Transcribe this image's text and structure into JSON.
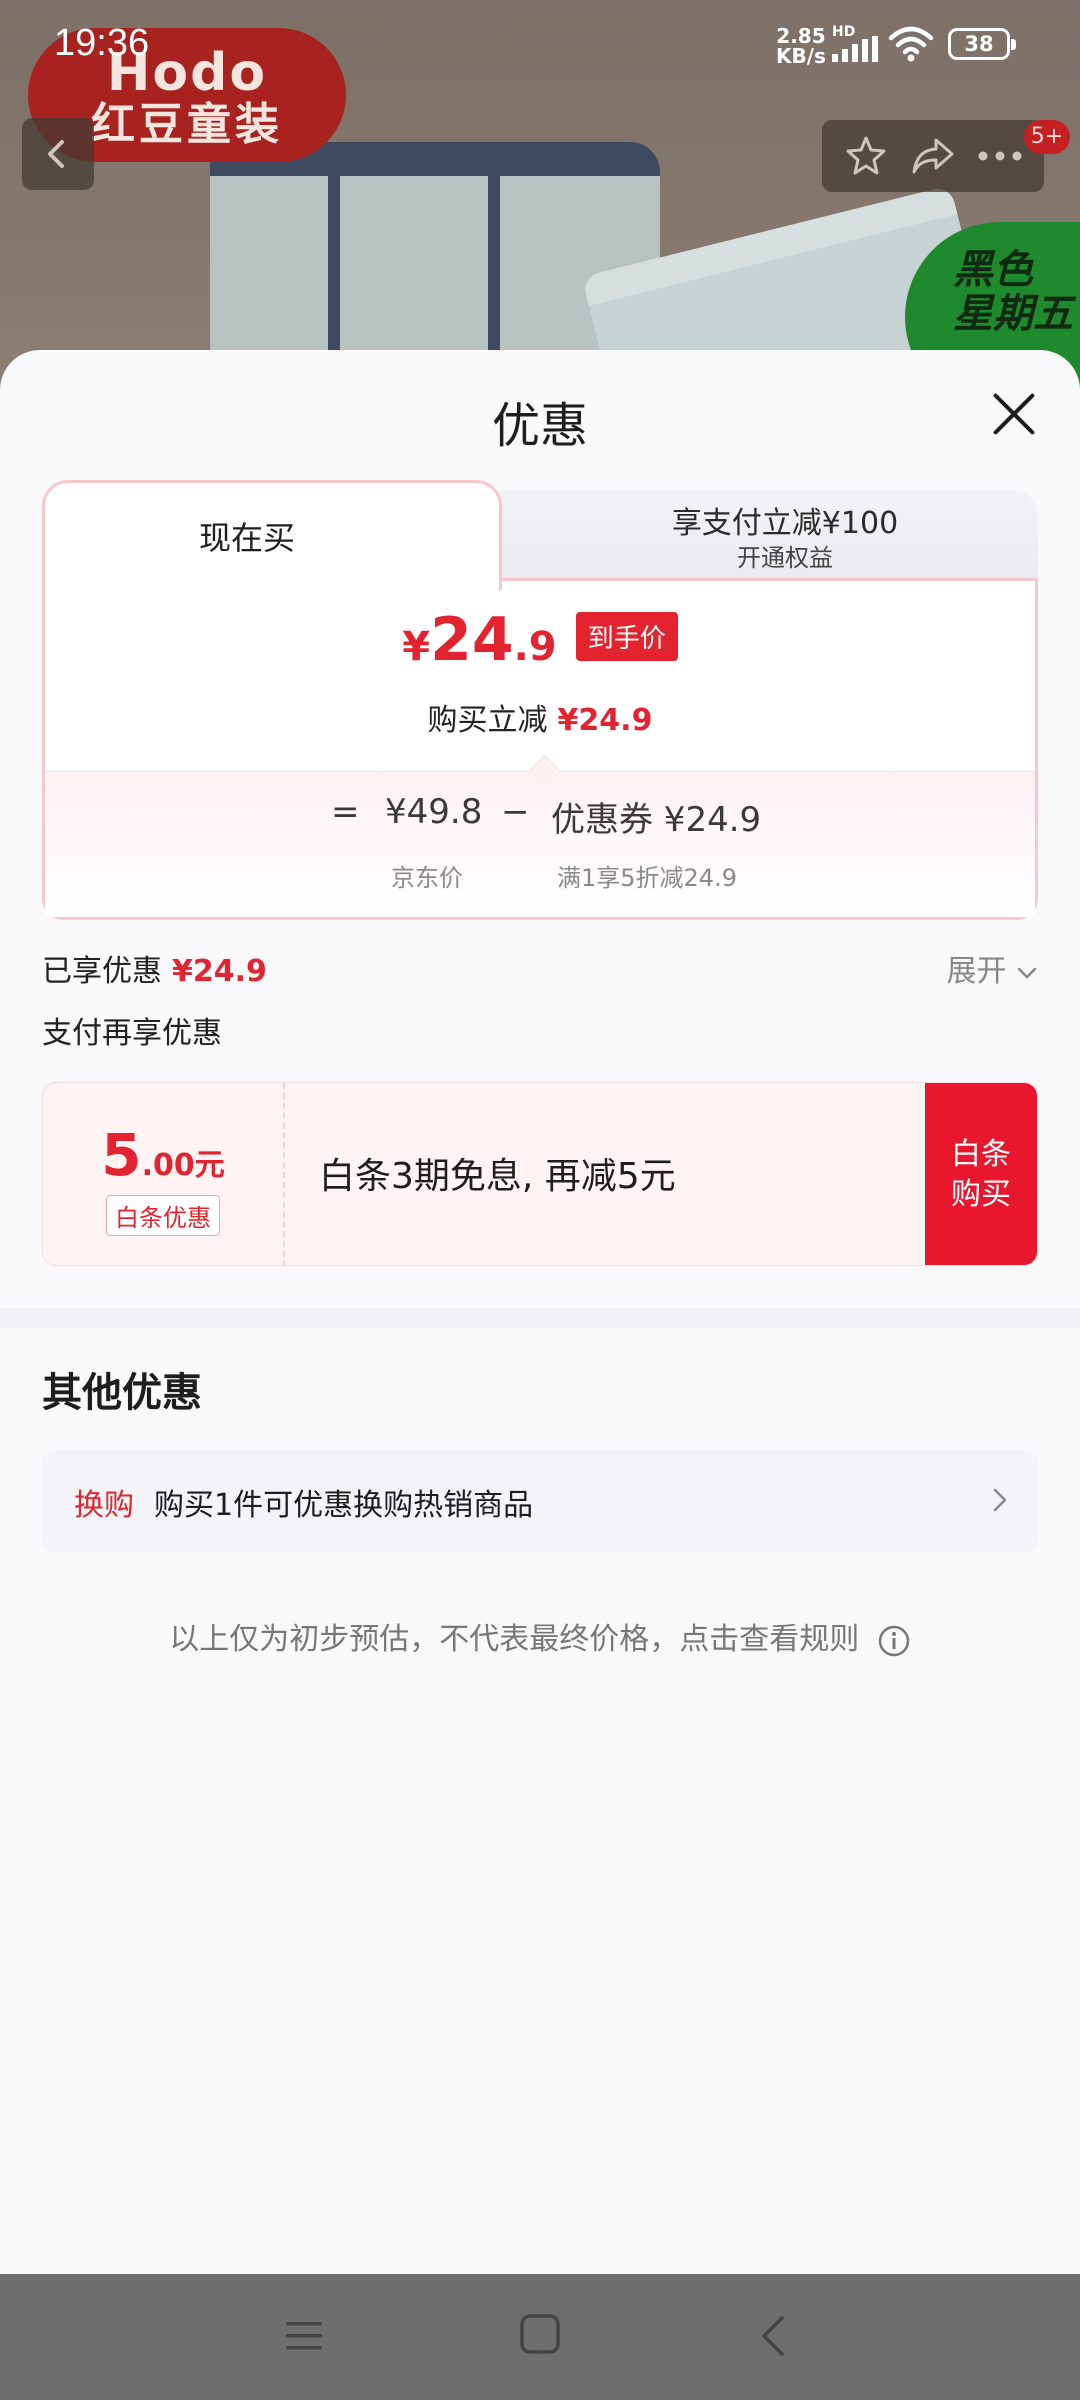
{
  "status_bar": {
    "time": "19:36",
    "net_speed_value": "2.85",
    "net_speed_unit": "KB/s",
    "hd_label": "HD",
    "battery": "38"
  },
  "background": {
    "brand_name_en": "Hodo",
    "brand_name_cn": "红豆童装",
    "sale_badge_line1": "黑色",
    "sale_badge_line2": "星期五",
    "message_count": "5+"
  },
  "sheet": {
    "title": "优惠",
    "tabs": [
      {
        "label": "现在买"
      },
      {
        "label": "享支付立减¥100",
        "sublabel": "开通权益"
      }
    ],
    "price": {
      "yen": "¥",
      "integer": "24",
      "decimal": ".9",
      "tag": "到手价",
      "discount_label": "购买立减",
      "discount_amount": "¥24.9"
    },
    "breakdown": {
      "equals": "=",
      "jd_price": "¥49.8",
      "minus": "−",
      "coupon": "优惠券 ¥24.9",
      "jd_price_label": "京东价",
      "coupon_label": "满1享5折减24.9"
    },
    "enjoyed": {
      "label": "已享优惠",
      "amount": "¥24.9",
      "expand": "展开"
    },
    "pay_more_title": "支付再享优惠",
    "baitiao": {
      "amount_int": "5",
      "amount_dec": ".00元",
      "tag": "白条优惠",
      "text": "白条3期免息, 再减5元",
      "buy_line1": "白条",
      "buy_line2": "购买"
    },
    "other_title": "其他优惠",
    "swap": {
      "tag": "换购",
      "text": "购买1件可优惠换购热销商品"
    },
    "disclaimer": "以上仅为初步预估，不代表最终价格，点击查看规则"
  },
  "icons": {
    "back": "chevron-left-icon",
    "star": "star-icon",
    "share": "share-icon",
    "more": "more-icon",
    "close": "close-icon",
    "chevron_down": "chevron-down-icon",
    "chevron_right": "chevron-right-icon",
    "info": "info-icon"
  },
  "colors": {
    "accent_red": "#e1242f",
    "sheet_bg": "#f9f8fb",
    "buy_button": "#e8172d"
  }
}
